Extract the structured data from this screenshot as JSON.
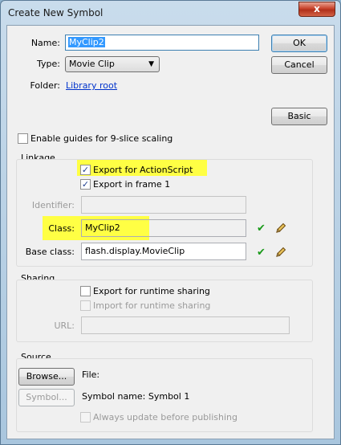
{
  "window": {
    "title": "Create New Symbol",
    "close_glyph": "x"
  },
  "general": {
    "name_label": "Name:",
    "name_value": "MyClip2",
    "type_label": "Type:",
    "type_value": "Movie Clip",
    "folder_label": "Folder:",
    "folder_link": "Library root",
    "ok_label": "OK",
    "cancel_label": "Cancel",
    "basic_label": "Basic",
    "guides_label": "Enable guides for 9-slice scaling",
    "guides_checked": false
  },
  "linkage": {
    "title": "Linkage",
    "export_as_label": "Export for ActionScript",
    "export_as_checked": true,
    "export_frame_label": "Export in frame 1",
    "export_frame_checked": true,
    "identifier_label": "Identifier:",
    "identifier_value": "",
    "class_label": "Class:",
    "class_value": "MyClip2",
    "base_class_label": "Base class:",
    "base_class_value": "flash.display.MovieClip",
    "highlight_color": "#ffff44"
  },
  "sharing": {
    "title": "Sharing",
    "export_runtime_label": "Export for runtime sharing",
    "export_runtime_checked": false,
    "import_runtime_label": "Import for runtime sharing",
    "import_runtime_checked": false,
    "url_label": "URL:",
    "url_value": ""
  },
  "source": {
    "title": "Source",
    "browse_label": "Browse...",
    "file_label": "File:",
    "symbol_btn_label": "Symbol...",
    "symbol_name_text": "Symbol name: Symbol 1",
    "always_update_label": "Always update before publishing",
    "always_update_checked": false
  },
  "icons": {
    "check": "check-icon",
    "pencil": "pencil-icon",
    "dropdown": "chevron-down-icon",
    "close": "close-icon"
  }
}
